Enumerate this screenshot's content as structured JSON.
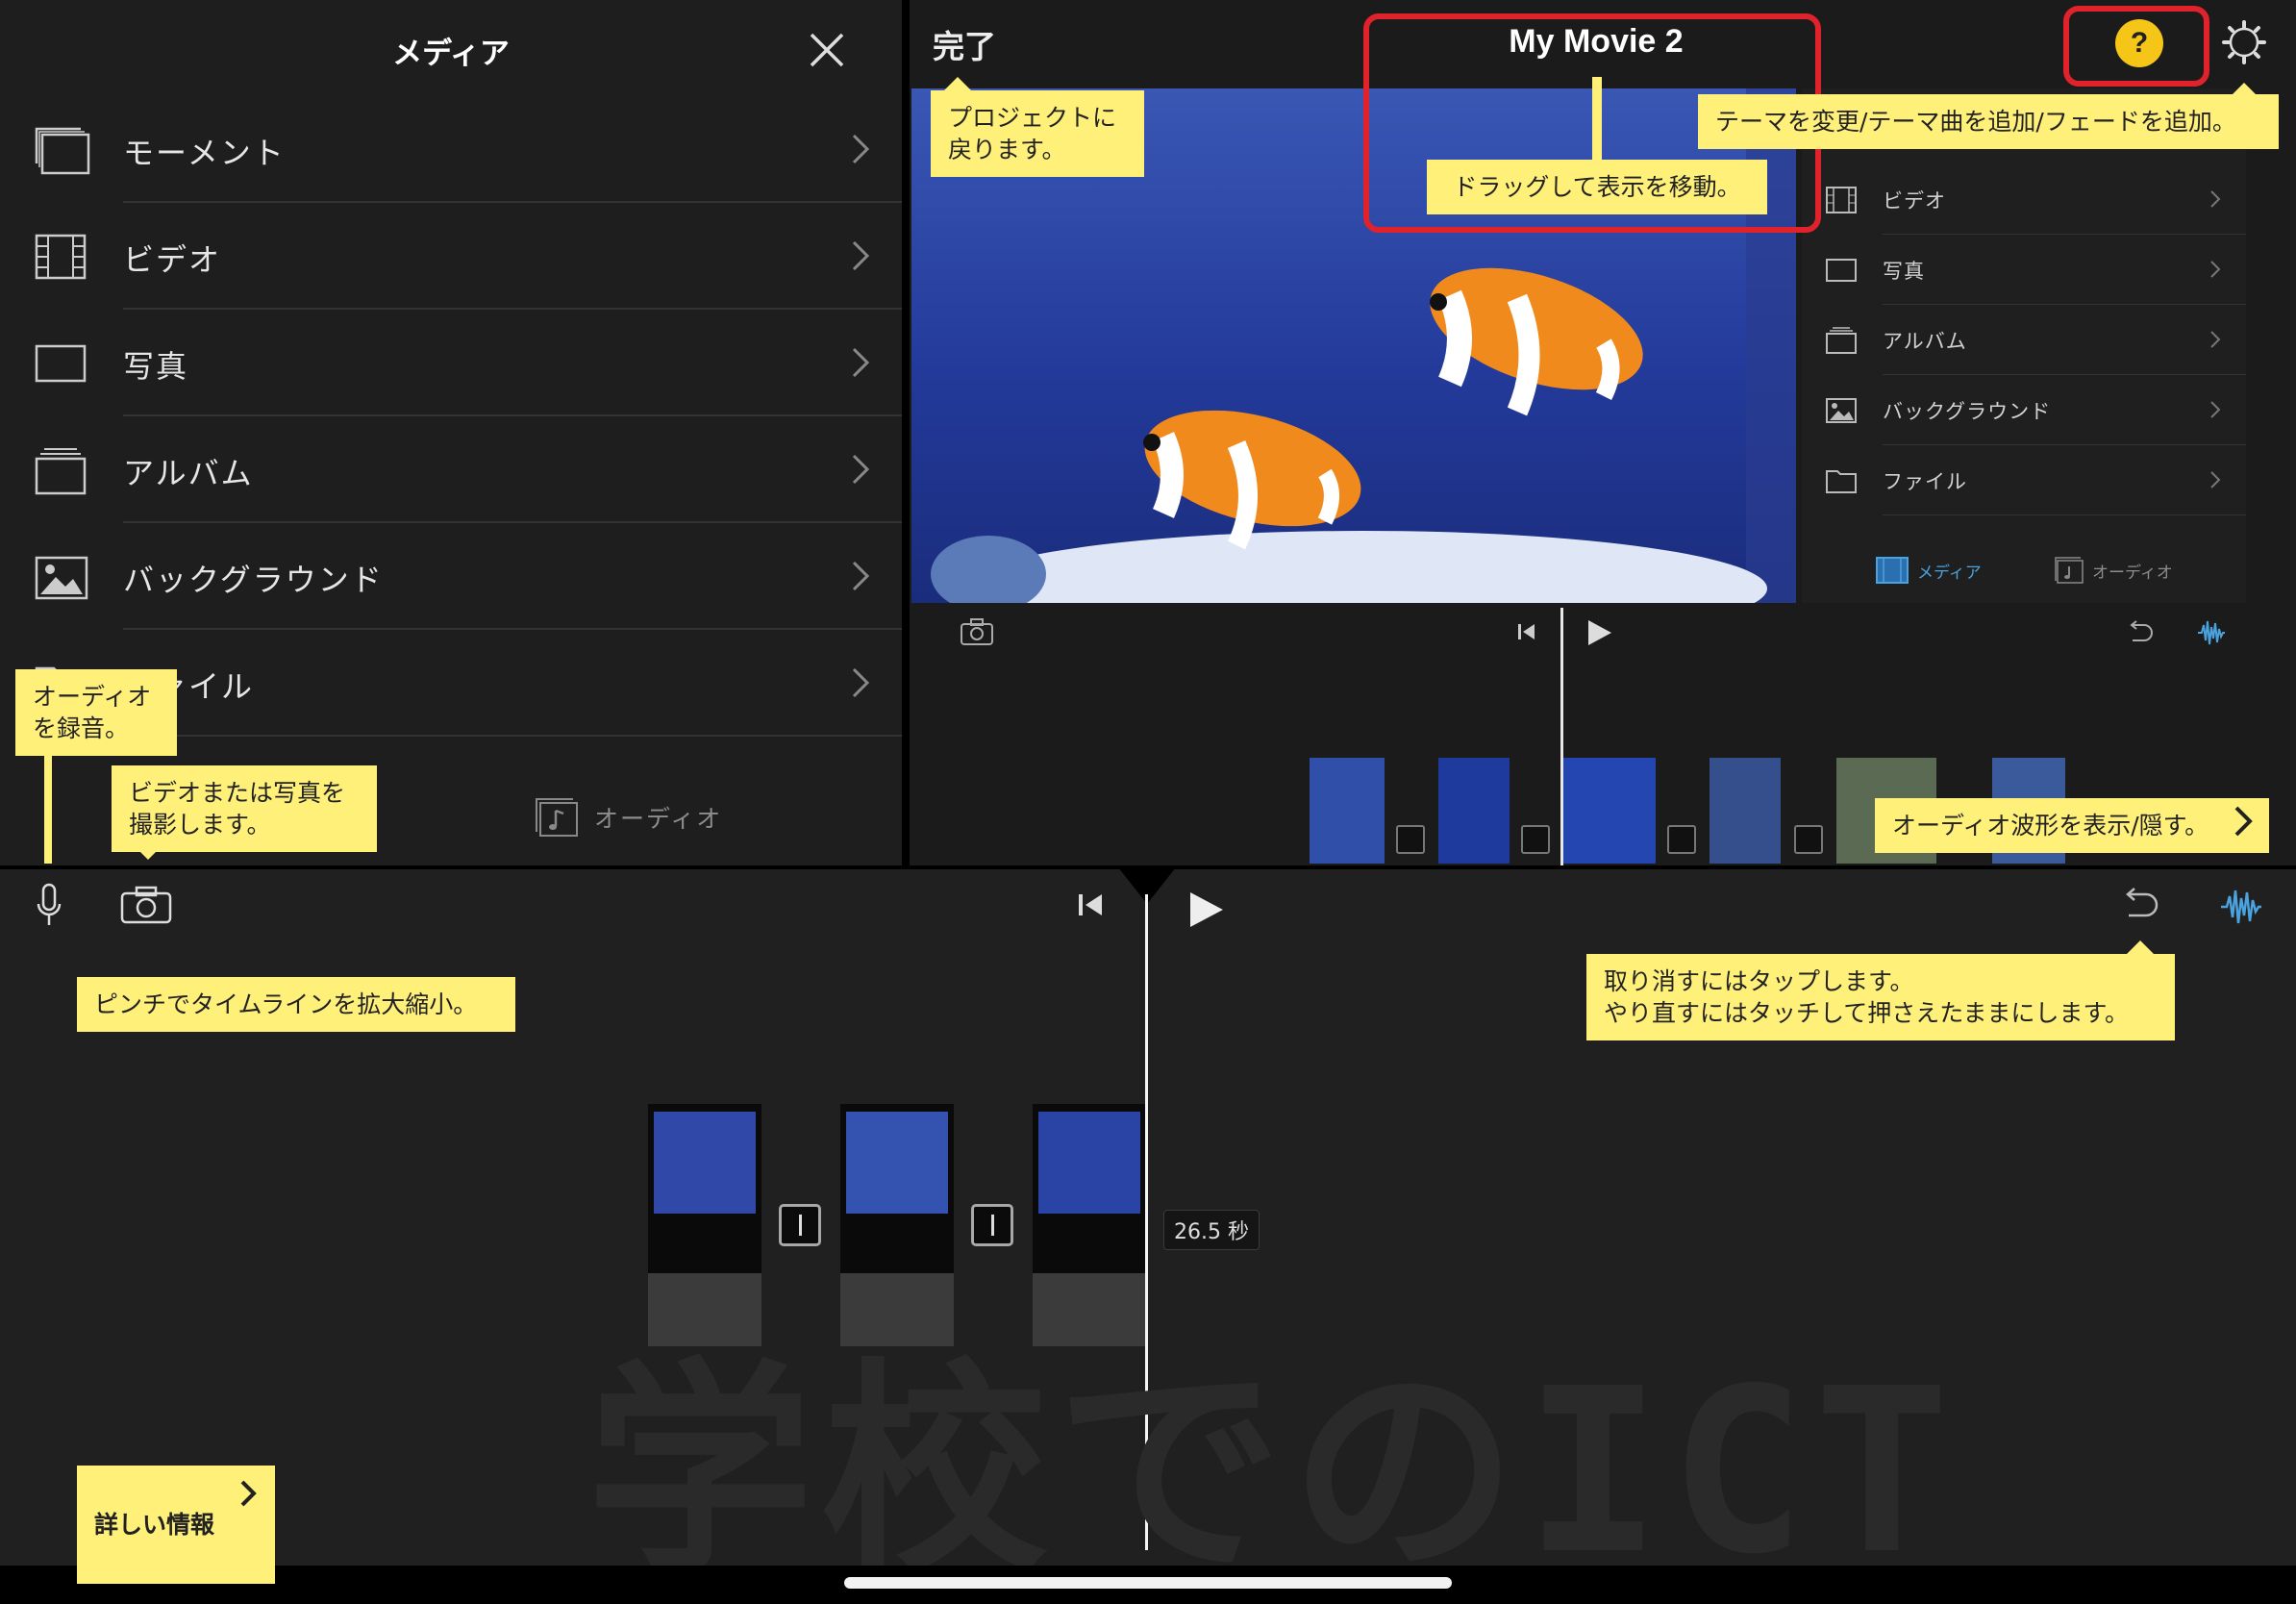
{
  "media_panel": {
    "title": "メディア",
    "items": [
      {
        "label": "モーメント",
        "icon": "moments-icon"
      },
      {
        "label": "ビデオ",
        "icon": "film-icon"
      },
      {
        "label": "写真",
        "icon": "photo-frame-icon"
      },
      {
        "label": "アルバム",
        "icon": "album-stack-icon"
      },
      {
        "label": "バックグラウンド",
        "icon": "landscape-image-icon"
      },
      {
        "label": "ファイル",
        "icon": "folder-icon"
      }
    ],
    "audio_tab": "オーディオ"
  },
  "header": {
    "done": "完了",
    "title": "My Movie 2",
    "help": "?"
  },
  "mini_panel": {
    "items": [
      {
        "label": "ビデオ",
        "icon": "film-icon"
      },
      {
        "label": "写真",
        "icon": "photo-frame-icon"
      },
      {
        "label": "アルバム",
        "icon": "album-stack-icon"
      },
      {
        "label": "バックグラウンド",
        "icon": "landscape-image-icon"
      },
      {
        "label": "ファイル",
        "icon": "folder-icon"
      }
    ],
    "tab_media": "メディア",
    "tab_audio": "オーディオ"
  },
  "timeline": {
    "duration": "26.5 秒"
  },
  "watermark": "学校でのICT",
  "tips": {
    "back": "プロジェクトに\n戻ります。",
    "drag": "ドラッグして表示を移動。",
    "theme": "テーマを変更/テーマ曲を追加/フェードを追加。",
    "record": "オーディオ\nを録音。",
    "camera": "ビデオまたは写真を\n撮影します。",
    "waveform": "オーディオ波形を表示/隠す。",
    "pinch": "ピンチでタイムラインを拡大縮小。",
    "undo": "取り消すにはタップします。\nやり直すにはタッチして押さえたままにします。",
    "more": "詳しい情報"
  },
  "colors": {
    "tip_yellow": "#fff07a",
    "highlight_red": "#e0232b",
    "help_yellow": "#f5c518",
    "accent_blue": "#4aa3df"
  }
}
